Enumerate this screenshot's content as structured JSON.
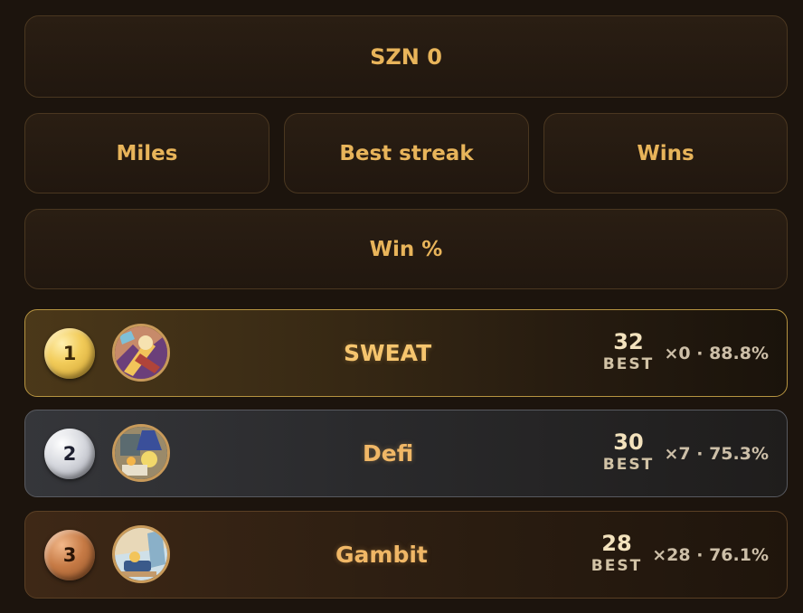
{
  "season": {
    "label": "SZN 0"
  },
  "categories": [
    {
      "label": "Miles"
    },
    {
      "label": "Best streak"
    },
    {
      "label": "Wins"
    },
    {
      "label": "Win %"
    }
  ],
  "leaderboard": [
    {
      "rank": "1",
      "name": "SWEAT",
      "score": "32",
      "score_label": "BEST",
      "meta": "×0 · 88.8%",
      "avatar": "sweat-avatar",
      "medal_color": "#f2cc5a"
    },
    {
      "rank": "2",
      "name": "Defi",
      "score": "30",
      "score_label": "BEST",
      "meta": "×7 · 75.3%",
      "avatar": "defi-avatar",
      "medal_color": "#d6d8de"
    },
    {
      "rank": "3",
      "name": "Gambit",
      "score": "28",
      "score_label": "BEST",
      "meta": "×28 · 76.1%",
      "avatar": "gambit-avatar",
      "medal_color": "#c67a45"
    }
  ],
  "colors": {
    "accent": "#e8b45a",
    "background": "#1c140d"
  }
}
